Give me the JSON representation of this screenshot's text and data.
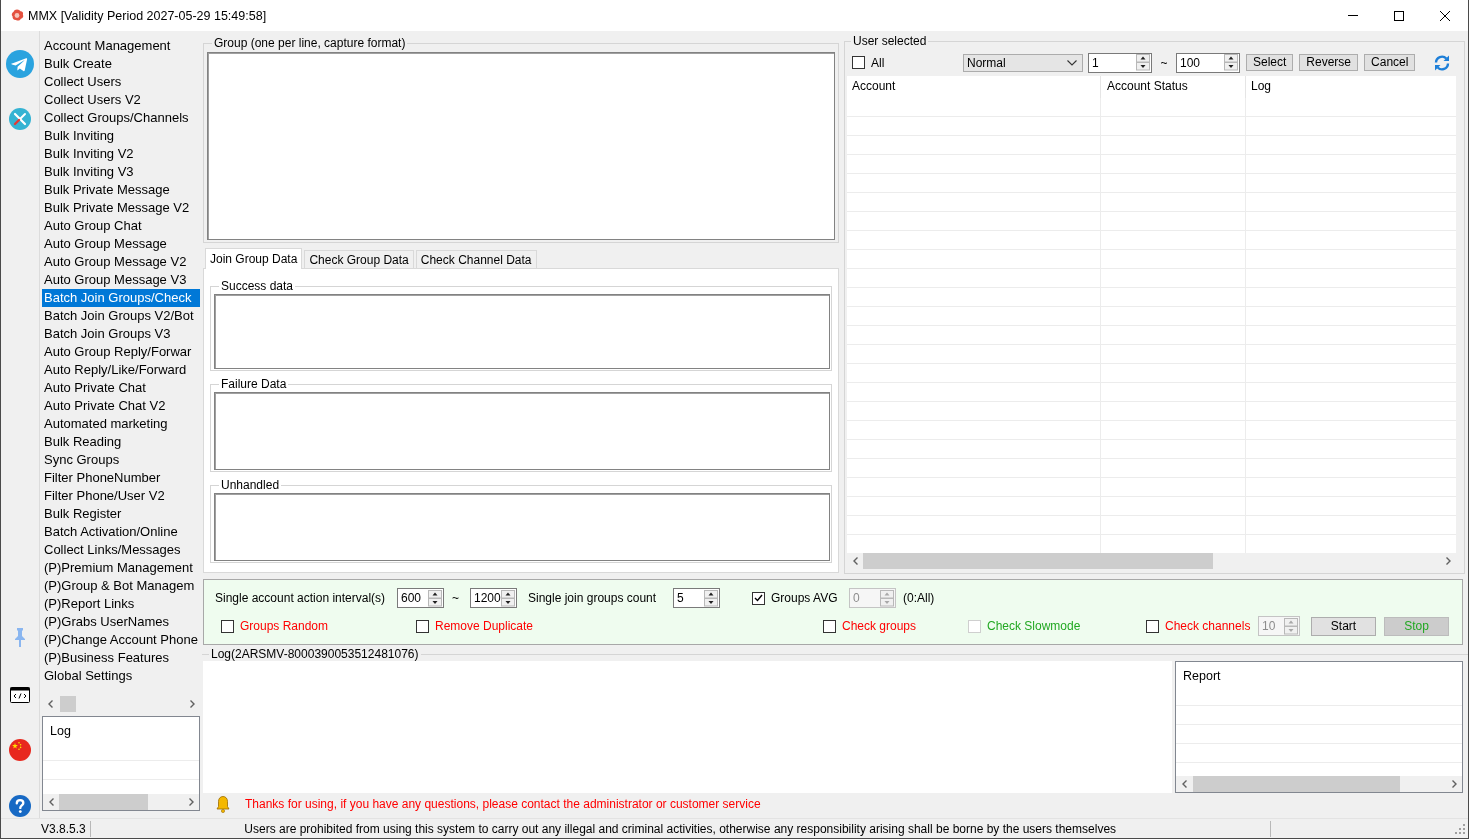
{
  "window": {
    "title": "MMX [Validity Period 2027-05-29 15:49:58]"
  },
  "sidebar": {
    "items": [
      {
        "label": "Account Management",
        "selected": false
      },
      {
        "label": "Bulk Create",
        "selected": false
      },
      {
        "label": "Collect Users",
        "selected": false
      },
      {
        "label": "Collect Users V2",
        "selected": false
      },
      {
        "label": "Collect Groups/Channels",
        "selected": false
      },
      {
        "label": "Bulk Inviting",
        "selected": false
      },
      {
        "label": "Bulk Inviting V2",
        "selected": false
      },
      {
        "label": "Bulk Inviting V3",
        "selected": false
      },
      {
        "label": "Bulk Private Message",
        "selected": false
      },
      {
        "label": "Bulk Private Message V2",
        "selected": false
      },
      {
        "label": "Auto Group Chat",
        "selected": false
      },
      {
        "label": "Auto Group Message",
        "selected": false
      },
      {
        "label": "Auto Group Message V2",
        "selected": false
      },
      {
        "label": "Auto Group Message V3",
        "selected": false
      },
      {
        "label": "Batch Join Groups/Check",
        "selected": true
      },
      {
        "label": "Batch Join Groups V2/Bot",
        "selected": false
      },
      {
        "label": "Batch Join Groups V3",
        "selected": false
      },
      {
        "label": "Auto Group Reply/Forwar",
        "selected": false
      },
      {
        "label": "Auto Reply/Like/Forward",
        "selected": false
      },
      {
        "label": "Auto Private Chat",
        "selected": false
      },
      {
        "label": "Auto Private Chat V2",
        "selected": false
      },
      {
        "label": "Automated marketing",
        "selected": false
      },
      {
        "label": "Bulk Reading",
        "selected": false
      },
      {
        "label": "Sync Groups",
        "selected": false
      },
      {
        "label": "Filter PhoneNumber",
        "selected": false
      },
      {
        "label": "Filter Phone/User V2",
        "selected": false
      },
      {
        "label": "Bulk Register",
        "selected": false
      },
      {
        "label": "Batch Activation/Online",
        "selected": false
      },
      {
        "label": "Collect Links/Messages",
        "selected": false
      },
      {
        "label": "(P)Premium Management",
        "selected": false
      },
      {
        "label": "(P)Group & Bot Managem",
        "selected": false
      },
      {
        "label": "(P)Report Links",
        "selected": false
      },
      {
        "label": "(P)Grabs UserNames",
        "selected": false
      },
      {
        "label": "(P)Change Account Phone",
        "selected": false
      },
      {
        "label": "(P)Business Features",
        "selected": false
      },
      {
        "label": "Global Settings",
        "selected": false
      }
    ]
  },
  "sidebar_log": {
    "columns": [
      "Log"
    ]
  },
  "group_box": {
    "legend": "Group (one per line, capture format)"
  },
  "tabs": [
    {
      "label": "Join Group Data",
      "selected": true
    },
    {
      "label": "Check Group Data",
      "selected": false
    },
    {
      "label": "Check Channel Data",
      "selected": false
    }
  ],
  "tab_sections": [
    {
      "legend": "Success data"
    },
    {
      "legend": "Failure Data"
    },
    {
      "legend": "Unhandled"
    }
  ],
  "user_selected": {
    "legend": "User selected",
    "select_all": {
      "label": "All",
      "checked": false
    },
    "mode": "Normal",
    "range_from": "1",
    "range_separator": "~",
    "range_to": "100",
    "buttons": [
      "Select",
      "Reverse",
      "Cancel"
    ],
    "columns": [
      "Account",
      "Account Status",
      "Log"
    ]
  },
  "options": {
    "rows": [
      {
        "items": [
          {
            "kind": "label",
            "text": "Single account action interval(s)"
          },
          {
            "kind": "spin",
            "value": "600",
            "disabled": false
          },
          {
            "kind": "label",
            "text": "~"
          },
          {
            "kind": "spin",
            "value": "1200",
            "disabled": false
          },
          {
            "kind": "label",
            "text": "Single join groups count"
          },
          {
            "kind": "spin",
            "value": "5",
            "disabled": false
          },
          {
            "kind": "checkbox",
            "label": "Groups AVG",
            "checked": true,
            "disabled": false,
            "color": "#000000"
          },
          {
            "kind": "spin",
            "value": "0",
            "disabled": true
          },
          {
            "kind": "label",
            "text": "(0:All)"
          }
        ]
      },
      {
        "items": [
          {
            "kind": "checkbox",
            "label": "Groups Random",
            "checked": false,
            "disabled": false,
            "color": "#ff0000"
          },
          {
            "kind": "checkbox",
            "label": "Remove Duplicate",
            "checked": false,
            "disabled": false,
            "color": "#ff0000"
          },
          {
            "kind": "checkbox",
            "label": "Check groups",
            "checked": false,
            "disabled": false,
            "color": "#ff0000"
          },
          {
            "kind": "checkbox",
            "label": "Check Slowmode",
            "checked": false,
            "disabled": true,
            "color": "#22a822"
          },
          {
            "kind": "checkbox",
            "label": "Check channels",
            "checked": false,
            "disabled": false,
            "color": "#ff0000"
          },
          {
            "kind": "spin",
            "value": "10",
            "disabled": true
          },
          {
            "kind": "button",
            "label": "Start",
            "disabled": false,
            "color": "#000000"
          },
          {
            "kind": "button",
            "label": "Stop",
            "disabled": true,
            "color": "#22a822"
          }
        ]
      }
    ]
  },
  "log_box": {
    "legend": "Log(2ARSMV-8000390053512481076)",
    "report_columns": [
      "Report"
    ]
  },
  "notice": "Thanks for using, if you have any questions, please contact the administrator or customer service",
  "status_bar": {
    "version": "V3.8.5.3",
    "message": "Users are prohibited from using this system to carry out any illegal and criminal activities, otherwise any responsibility arising shall be borne by the users themselves"
  }
}
